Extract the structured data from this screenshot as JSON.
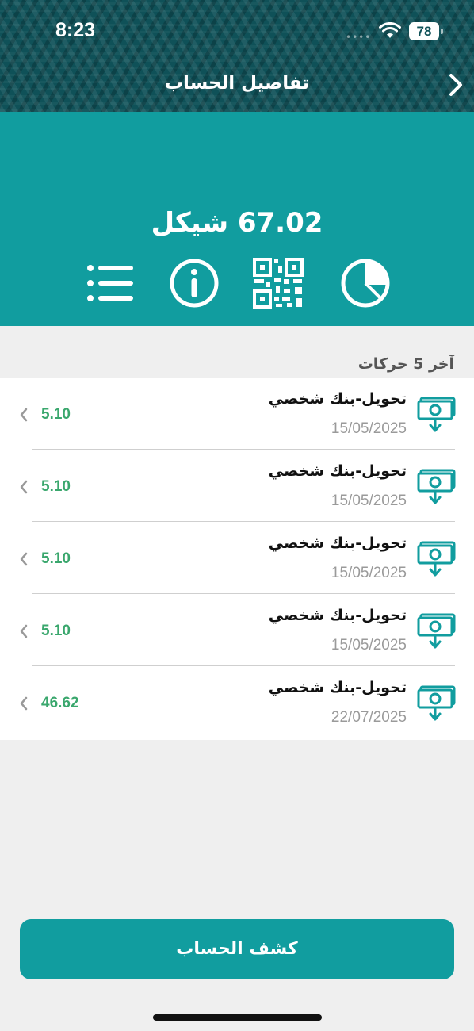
{
  "status_bar": {
    "time": "8:23",
    "battery": "78",
    "dots": "••••"
  },
  "header": {
    "title": "تفاصيل الحساب",
    "back_icon": "chevron-right-icon"
  },
  "balance": {
    "text": "67.02 شيكل"
  },
  "actions": [
    {
      "icon": "list-icon"
    },
    {
      "icon": "info-icon"
    },
    {
      "icon": "qr-code-icon"
    },
    {
      "icon": "pie-chart-icon"
    }
  ],
  "section_title": "آخر 5 حركات",
  "transactions": [
    {
      "description": "تحويل-بنك شخصي",
      "date": "15/05/2025",
      "amount": "5.10"
    },
    {
      "description": "تحويل-بنك شخصي",
      "date": "15/05/2025",
      "amount": "5.10"
    },
    {
      "description": "تحويل-بنك شخصي",
      "date": "15/05/2025",
      "amount": "5.10"
    },
    {
      "description": "تحويل-بنك شخصي",
      "date": "15/05/2025",
      "amount": "5.10"
    },
    {
      "description": "تحويل-بنك شخصي",
      "date": "22/07/2025",
      "amount": "46.62"
    }
  ],
  "statement_button": "كشف الحساب",
  "colors": {
    "teal": "#119d9f",
    "header": "#0f5158",
    "amount_green": "#3aa76d"
  }
}
